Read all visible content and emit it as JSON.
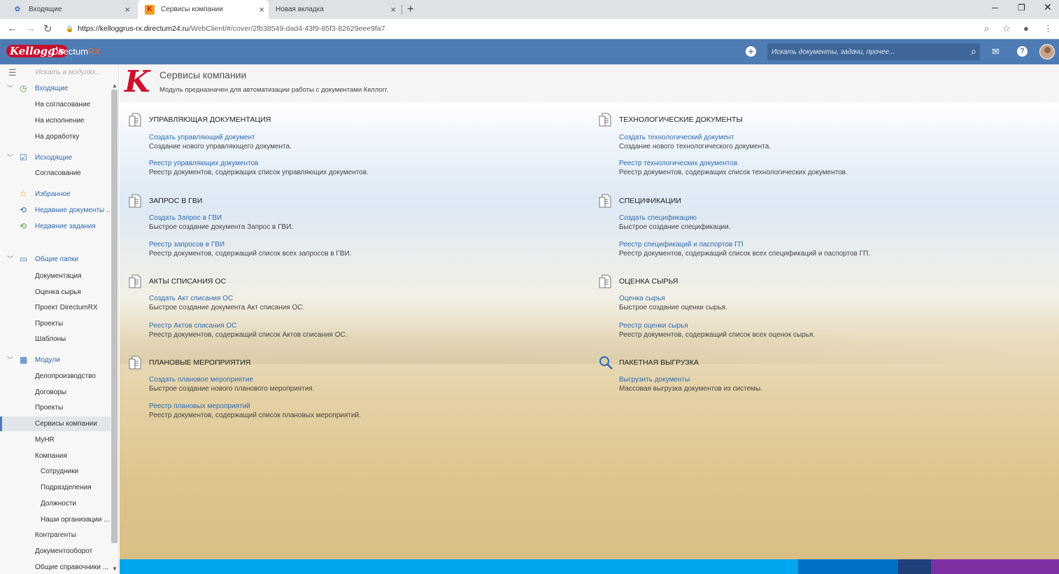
{
  "browser": {
    "tabs": [
      {
        "label": "Входящие"
      },
      {
        "label": "Сервисы компании"
      },
      {
        "label": "Новая вкладка"
      }
    ],
    "url_host": "https://kelloggrus-rx.directum24.ru",
    "url_path": "/WebClient/#/cover/2fb38549-dad4-43f9-85f3-82629eee9fa7"
  },
  "header": {
    "logo_text": "Kellogg's",
    "brand_prefix": "Directum",
    "brand_suffix": "RX",
    "search_placeholder": "Искать документы, задачи, прочее..."
  },
  "sidebar": {
    "search_placeholder": "Искать в модулях...",
    "items": [
      {
        "label": "Входящие"
      },
      {
        "label": "На согласование"
      },
      {
        "label": "На исполнение"
      },
      {
        "label": "На доработку"
      },
      {
        "label": "Исходящие"
      },
      {
        "label": "Согласование"
      },
      {
        "label": "Избранное"
      },
      {
        "label": "Недавние документы ..."
      },
      {
        "label": "Недавние задания"
      },
      {
        "label": "Общие папки"
      },
      {
        "label": "Документация"
      },
      {
        "label": "Оценка сырья"
      },
      {
        "label": "Проект DirectumRX"
      },
      {
        "label": "Проекты"
      },
      {
        "label": "Шаблоны"
      },
      {
        "label": "Модули"
      },
      {
        "label": "Делопроизводство"
      },
      {
        "label": "Договоры"
      },
      {
        "label": "Проекты"
      },
      {
        "label": "Сервисы компании"
      },
      {
        "label": "MyHR"
      },
      {
        "label": "Компания"
      },
      {
        "label": "Сотрудники"
      },
      {
        "label": "Подразделения"
      },
      {
        "label": "Должности"
      },
      {
        "label": "Наши организации ..."
      },
      {
        "label": "Контрагенты"
      },
      {
        "label": "Документооборот"
      },
      {
        "label": "Общие справочники ..."
      }
    ]
  },
  "page": {
    "title": "Сервисы компании",
    "subtitle": "Модуль предназначен для автоматизации работы с документами Келлогг."
  },
  "sections": [
    {
      "title": "УПРАВЛЯЮЩАЯ ДОКУМЕНТАЦИЯ",
      "link1": "Создать управляющий документ",
      "desc1": "Создание нового управляющего документа.",
      "link2": "Реестр управляющих документов",
      "desc2": "Реестр документов, содержащих список управляющих документов."
    },
    {
      "title": "ТЕХНОЛОГИЧЕСКИЕ ДОКУМЕНТЫ",
      "link1": "Создать технологический документ",
      "desc1": "Создание нового технологического документа.",
      "link2": "Реестр технологических документов",
      "desc2": "Реестр документов, содержащих список технологических документов."
    },
    {
      "title": "ЗАПРОС В ГВИ",
      "link1": "Создать Запрос в ГВИ",
      "desc1": "Быстрое создание документа Запрос в ГВИ.",
      "link2": "Реестр запросов в ГВИ",
      "desc2": "Реестр документов, содержащий список всех запросов в ГВИ."
    },
    {
      "title": "СПЕЦИФИКАЦИИ",
      "link1": "Создать спецификацию",
      "desc1": "Быстрое создание спецификации.",
      "link2": "Реестр спецификаций и паспортов ГП",
      "desc2": "Реестр документов, содержащий список всех спецификаций и паспортов ГП."
    },
    {
      "title": "АКТЫ СПИСАНИЯ ОС",
      "link1": "Создать Акт списания ОС",
      "desc1": "Быстрое создание документа Акт списания ОС.",
      "link2": "Реестр Актов списания ОС",
      "desc2": "Реестр документов, содержащий список Актов списания ОС."
    },
    {
      "title": "ОЦЕНКА СЫРЬЯ",
      "link1": "Оценка сырья",
      "desc1": "Быстрое создание оценки сырья.",
      "link2": "Реестр оценки сырья",
      "desc2": "Реестр документов, содержащий список всех оценок сырья."
    },
    {
      "title": "ПЛАНОВЫЕ МЕРОПРИЯТИЯ",
      "link1": "Создать плановое мероприятие",
      "desc1": "Быстрое создание нового планового мероприятия.",
      "link2": "Реестр плановых мероприятий",
      "desc2": "Реестр документов, содержащий список плановых мероприятий."
    },
    {
      "title": "ПАКЕТНАЯ ВЫГРУЗКА",
      "link1": "Выгрузить документы",
      "desc1": "Массовая выгрузка документов из системы."
    }
  ],
  "colors": {
    "header_bg": "#4e7bb4",
    "link": "#2e6bb0",
    "footer_segments": [
      "#00a6ee",
      "#0072c6",
      "#1f3f7a",
      "#7d2fa3"
    ]
  }
}
